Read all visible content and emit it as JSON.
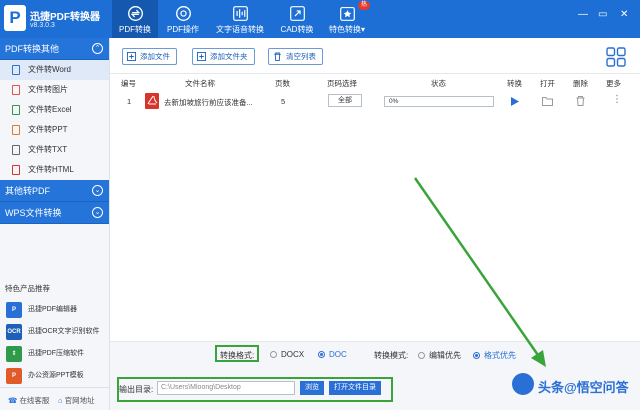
{
  "app": {
    "name": "迅捷PDF转换器",
    "version": "v8.3.0.3",
    "logo_letter": "P"
  },
  "tabs": [
    {
      "label": "PDF转换",
      "icon": "convert-icon"
    },
    {
      "label": "PDF操作",
      "icon": "pdf-tools-icon"
    },
    {
      "label": "文字语音转换",
      "icon": "audio-wave-icon"
    },
    {
      "label": "CAD转换",
      "icon": "cad-icon"
    },
    {
      "label": "特色转换▾",
      "icon": "special-icon",
      "badge": "热"
    }
  ],
  "window_controls": {
    "minimize": "—",
    "maximize": "▭",
    "close": "✕"
  },
  "sidebar": {
    "categories": [
      {
        "label": "PDF转换其他",
        "chev": "⌃",
        "items": [
          {
            "label": "文件转Word",
            "color": "#2b74d6"
          },
          {
            "label": "文件转图片",
            "color": "#e0554a"
          },
          {
            "label": "文件转Excel",
            "color": "#2f9a4b"
          },
          {
            "label": "文件转PPT",
            "color": "#e07a2e"
          },
          {
            "label": "文件转TXT",
            "color": "#666666"
          },
          {
            "label": "文件转HTML",
            "color": "#d8342b"
          }
        ]
      },
      {
        "label": "其他转PDF",
        "chev": "⌄"
      },
      {
        "label": "WPS文件转换",
        "chev": "⌄"
      }
    ],
    "recommend_title": "特色产品推荐",
    "recommend": [
      {
        "label": "迅捷PDF编辑器",
        "icon_text": "P",
        "color": "#2a6fd6"
      },
      {
        "label": "迅捷OCR文字识别软件",
        "icon_text": "OCR",
        "color": "#1d5fb9"
      },
      {
        "label": "迅捷PDF压缩软件",
        "icon_text": "⇕",
        "color": "#2f9a4b"
      },
      {
        "label": "办公资源PPT模板",
        "icon_text": "P",
        "color": "#e05a2a"
      }
    ],
    "footer": {
      "service": "在线客服",
      "website": "官网地址"
    }
  },
  "toolbar": {
    "add_file": "添加文件",
    "add_folder": "添加文件夹",
    "clear_list": "清空列表"
  },
  "table": {
    "headers": [
      "编号",
      "文件名称",
      "页数",
      "页码选择",
      "状态",
      "转换",
      "打开",
      "删除",
      "更多"
    ],
    "rows": [
      {
        "index": "1",
        "name": "去新加坡旅行前应该准备...",
        "pages": "5",
        "page_select": "全部",
        "status": "0%",
        "progress": 0
      }
    ]
  },
  "format": {
    "label": "转换格式:",
    "options": [
      "DOCX",
      "DOC"
    ],
    "selected": "DOC",
    "mode_label": "转换模式:",
    "modes": [
      "编辑优先",
      "格式优先"
    ],
    "selected_mode": "格式优先"
  },
  "output": {
    "label": "输出目录:",
    "path": "C:\\Users\\Mloong\\Desktop",
    "browse": "浏览",
    "open_folder": "打开文件目录"
  },
  "watermark": "头条@悟空问答",
  "colors": {
    "primary": "#1d6fd6",
    "highlight": "#3aa43a",
    "pdf_red": "#d8342b"
  }
}
